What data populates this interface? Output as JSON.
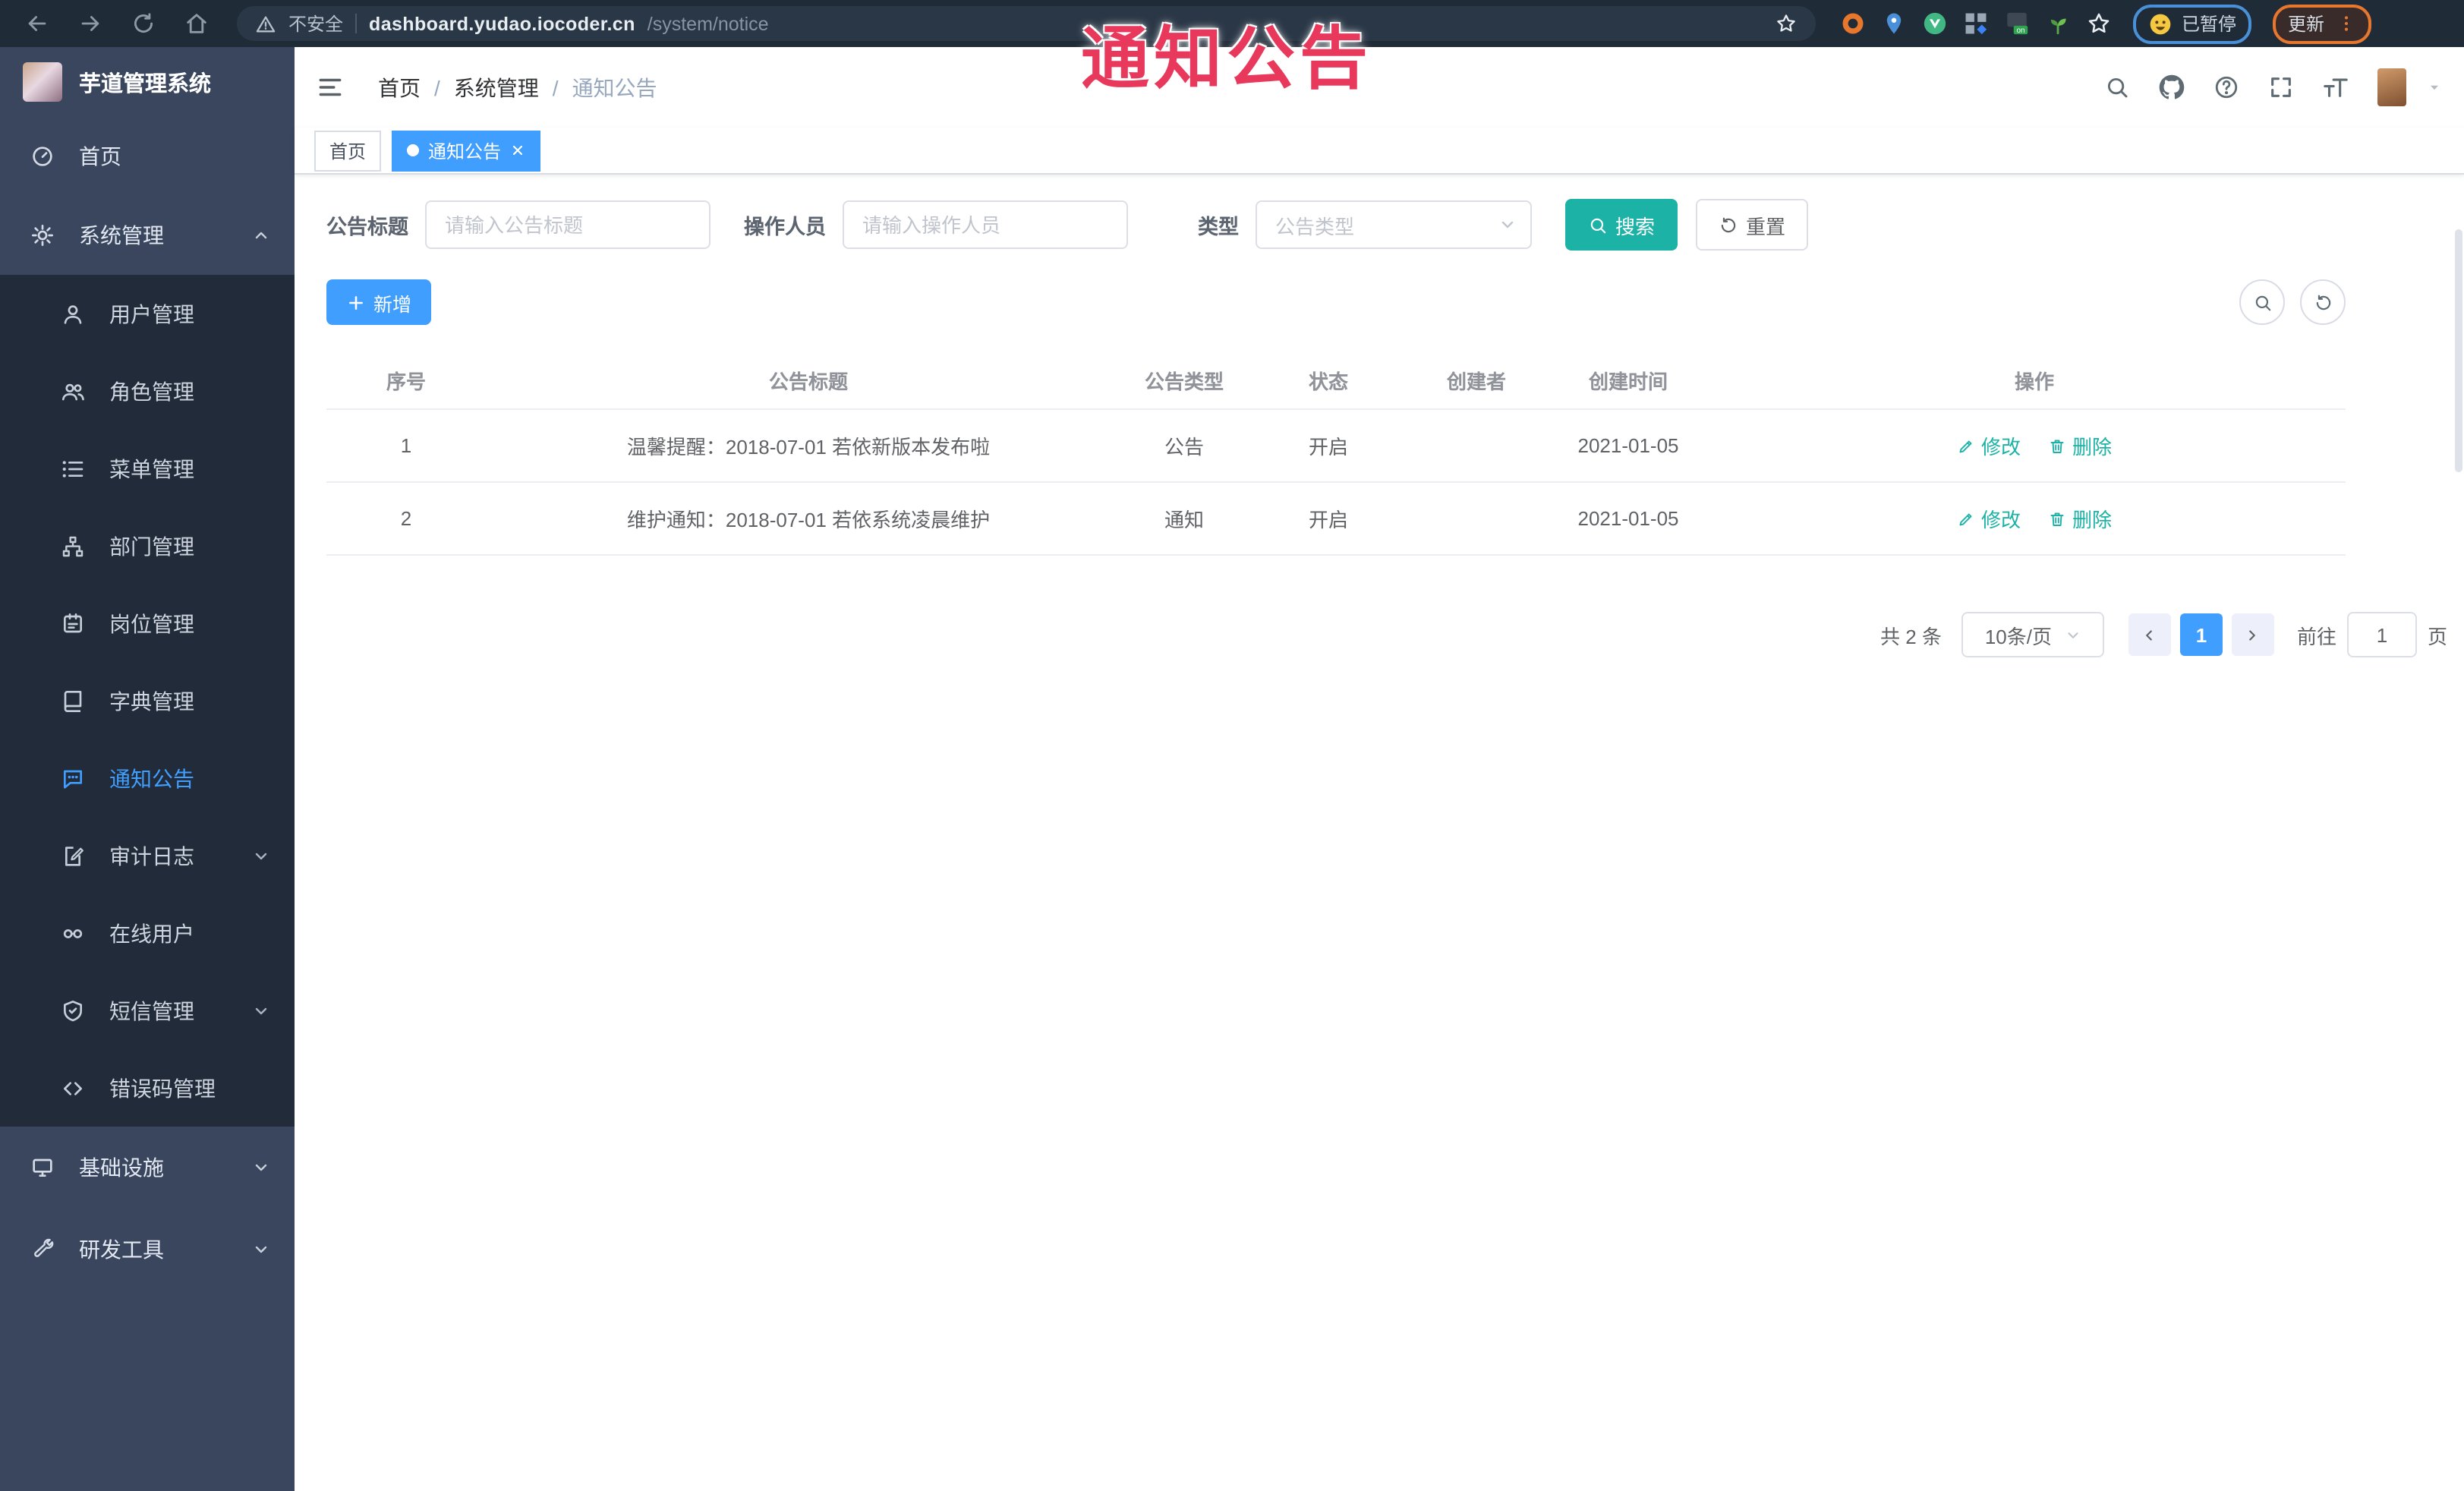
{
  "annotation": {
    "text": "通知公告",
    "color": "#e8395c"
  },
  "browser": {
    "security_label": "不安全",
    "url_host": "dashboard.yudao.iocoder.cn",
    "url_path": "/system/notice",
    "profile_status": "已暂停",
    "update_label": "更新"
  },
  "sidebar": {
    "title": "芋道管理系统",
    "items": [
      {
        "label": "首页",
        "icon": "dashboard-icon"
      },
      {
        "label": "系统管理",
        "icon": "gear-icon",
        "chevron": "up"
      },
      {
        "label": "用户管理",
        "icon": "user-icon"
      },
      {
        "label": "角色管理",
        "icon": "users-icon"
      },
      {
        "label": "菜单管理",
        "icon": "menu-list-icon"
      },
      {
        "label": "部门管理",
        "icon": "org-tree-icon"
      },
      {
        "label": "岗位管理",
        "icon": "badge-icon"
      },
      {
        "label": "字典管理",
        "icon": "dictionary-icon"
      },
      {
        "label": "通知公告",
        "icon": "announcement-icon",
        "active": true
      },
      {
        "label": "审计日志",
        "icon": "audit-log-icon",
        "chevron": "down"
      },
      {
        "label": "在线用户",
        "icon": "online-users-icon"
      },
      {
        "label": "短信管理",
        "icon": "sms-icon",
        "chevron": "down"
      },
      {
        "label": "错误码管理",
        "icon": "error-code-icon"
      },
      {
        "label": "基础设施",
        "icon": "infrastructure-icon",
        "chevron": "down"
      },
      {
        "label": "研发工具",
        "icon": "devtools-icon",
        "chevron": "down"
      }
    ]
  },
  "header": {
    "breadcrumb": [
      "首页",
      "系统管理",
      "通知公告"
    ]
  },
  "tabs": [
    {
      "label": "首页"
    },
    {
      "label": "通知公告",
      "active": true
    }
  ],
  "filters": {
    "title_label": "公告标题",
    "title_placeholder": "请输入公告标题",
    "operator_label": "操作人员",
    "operator_placeholder": "请输入操作人员",
    "type_label": "类型",
    "type_placeholder": "公告类型",
    "search_label": "搜索",
    "reset_label": "重置"
  },
  "toolbar": {
    "add_label": "新增"
  },
  "table": {
    "columns": [
      "序号",
      "公告标题",
      "公告类型",
      "状态",
      "创建者",
      "创建时间",
      "操作"
    ],
    "rows": [
      {
        "no": "1",
        "title": "温馨提醒：2018-07-01 若依新版本发布啦",
        "type": "公告",
        "status": "开启",
        "creator": "",
        "created_at": "2021-01-05",
        "edit": "修改",
        "delete": "删除"
      },
      {
        "no": "2",
        "title": "维护通知：2018-07-01 若依系统凌晨维护",
        "type": "通知",
        "status": "开启",
        "creator": "",
        "created_at": "2021-01-05",
        "edit": "修改",
        "delete": "删除"
      }
    ]
  },
  "pagination": {
    "total": "共 2 条",
    "page_size": "10条/页",
    "current": "1",
    "goto_label": "前往",
    "goto_value": "1",
    "page_unit": "页"
  },
  "colors": {
    "accent_blue": "#409eff",
    "teal": "#1cb2a6",
    "sidebar_bg": "#39465e",
    "submenu_bg": "#212b39",
    "browser_bar_bg": "#202b38",
    "annotation_red": "#e8395c"
  }
}
